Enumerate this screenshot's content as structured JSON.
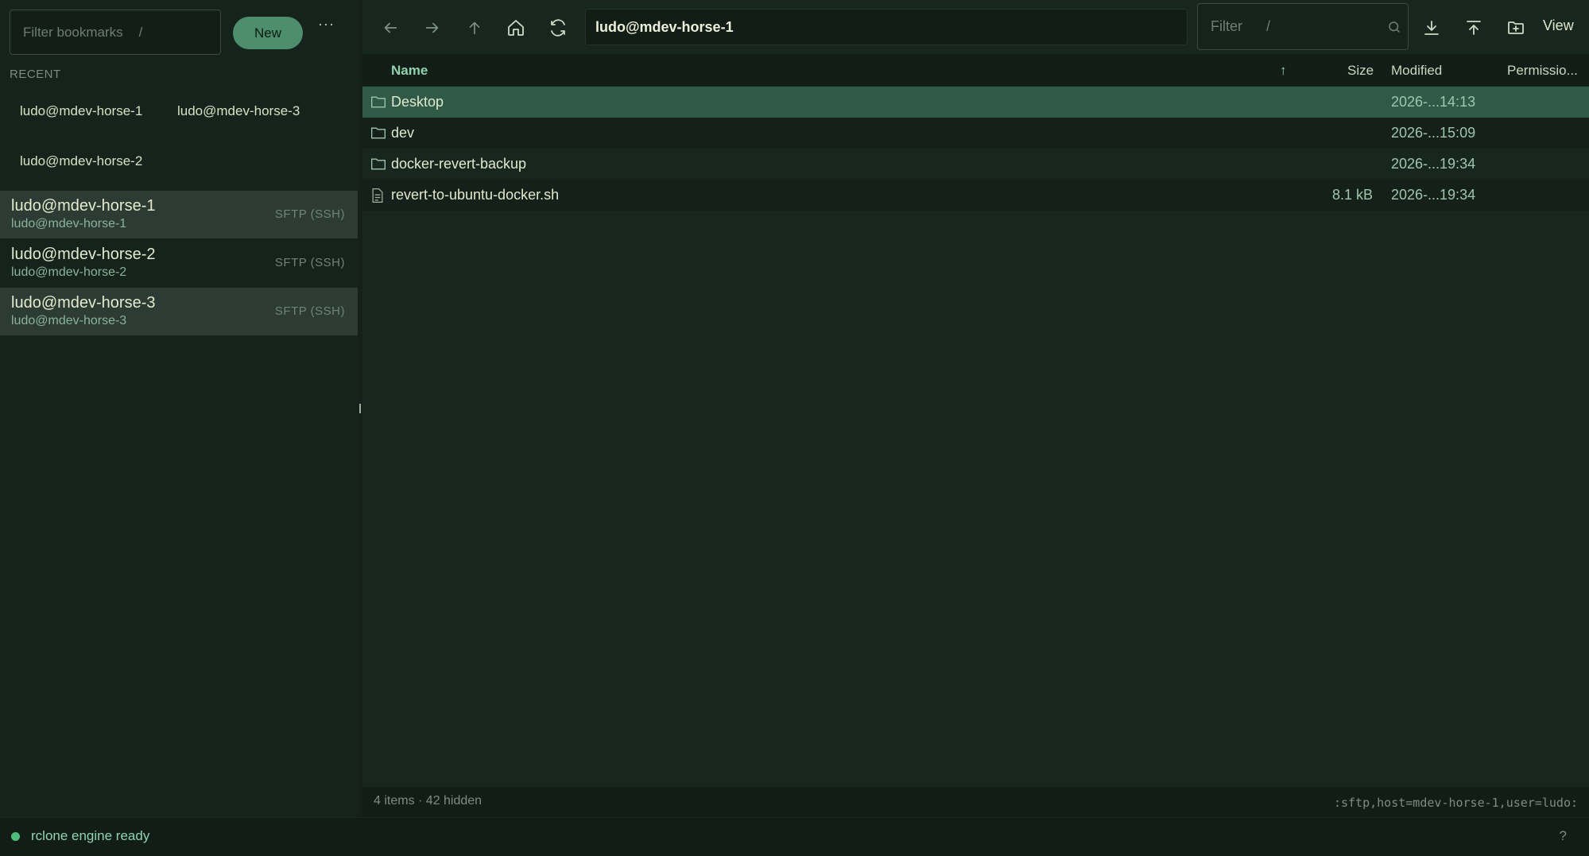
{
  "sidebar": {
    "filter_placeholder": "Filter bookmarks",
    "filter_shortcut": "/",
    "new_label": "New",
    "more_label": "···",
    "recent_label": "RECENT",
    "recent": [
      "ludo@mdev-horse-1",
      "ludo@mdev-horse-3",
      "ludo@mdev-horse-2"
    ],
    "bookmarks": [
      {
        "title": "ludo@mdev-horse-1",
        "subtitle": "ludo@mdev-horse-1",
        "protocol": "SFTP (SSH)",
        "selected": true
      },
      {
        "title": "ludo@mdev-horse-2",
        "subtitle": "ludo@mdev-horse-2",
        "protocol": "SFTP (SSH)",
        "selected": false
      },
      {
        "title": "ludo@mdev-horse-3",
        "subtitle": "ludo@mdev-horse-3",
        "protocol": "SFTP (SSH)",
        "selected": true
      }
    ]
  },
  "toolbar": {
    "path": "ludo@mdev-horse-1",
    "filter_placeholder": "Filter",
    "filter_shortcut": "/",
    "view_label": "View",
    "icons": [
      "back-icon",
      "forward-icon",
      "up-icon",
      "home-icon",
      "refresh-icon",
      "search-icon",
      "download-icon",
      "upload-icon",
      "new-folder-icon"
    ]
  },
  "table": {
    "columns": {
      "name": "Name",
      "size": "Size",
      "modified": "Modified",
      "permissions": "Permissio..."
    },
    "sort_indicator": "↑",
    "rows": [
      {
        "type": "folder",
        "name": "Desktop",
        "size": "",
        "modified": "2026-...14:13",
        "selected": true
      },
      {
        "type": "folder",
        "name": "dev",
        "size": "",
        "modified": "2026-...15:09",
        "selected": false
      },
      {
        "type": "folder",
        "name": "docker-revert-backup",
        "size": "",
        "modified": "2026-...19:34",
        "selected": false
      },
      {
        "type": "file",
        "name": "revert-to-ubuntu-docker.sh",
        "size": "8.1 kB",
        "modified": "2026-...19:34",
        "selected": false
      }
    ]
  },
  "footer": {
    "info": "4 items · 42 hidden",
    "remote": ":sftp,host=mdev-horse-1,user=ludo:"
  },
  "status": {
    "text": "rclone engine ready",
    "help": "?",
    "dot_color": "#4fbf7c"
  }
}
